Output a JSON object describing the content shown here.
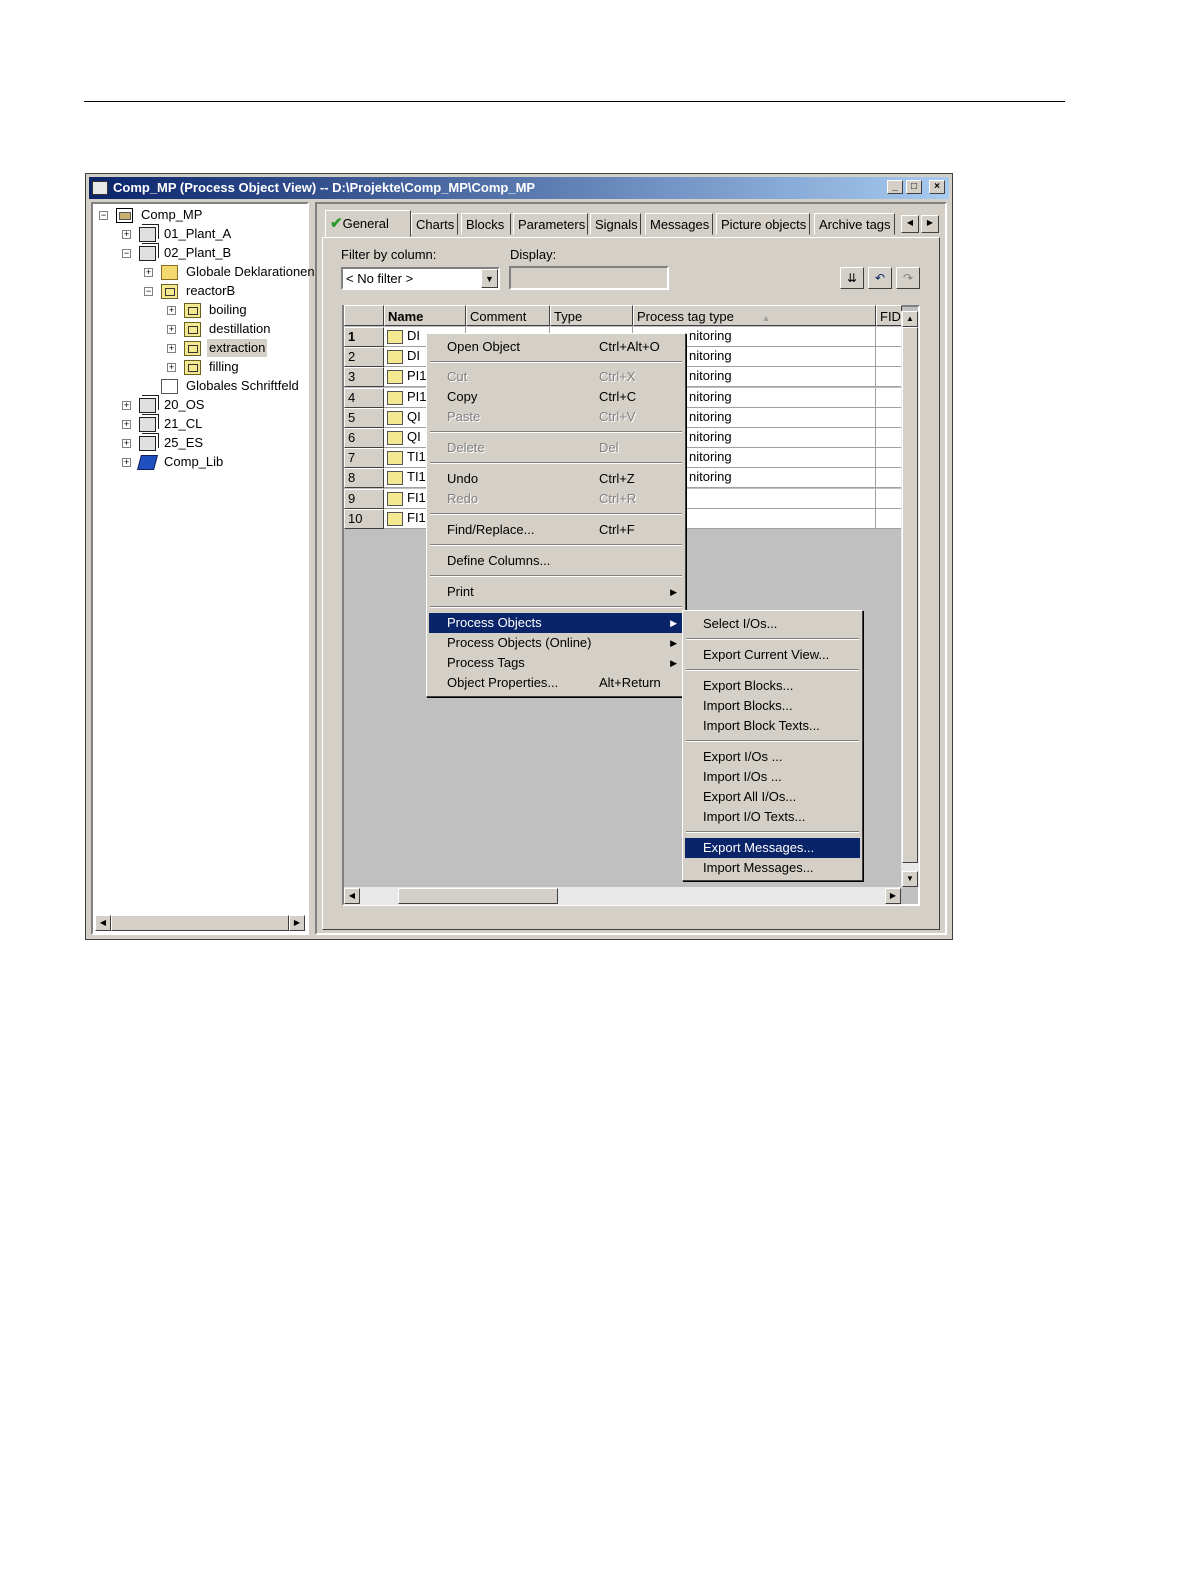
{
  "window": {
    "title": "Comp_MP (Process Object View) -- D:\\Projekte\\Comp_MP\\Comp_MP",
    "buttons": {
      "minimize": "_",
      "maximize": "□",
      "close": "×"
    }
  },
  "tree": {
    "items": [
      {
        "label": "Comp_MP",
        "icon": "project-icon",
        "expander": "−"
      },
      {
        "label": "01_Plant_A",
        "icon": "stack-icon",
        "expander": "+"
      },
      {
        "label": "02_Plant_B",
        "icon": "stack-icon",
        "expander": "−"
      },
      {
        "label": "Globale Deklarationen",
        "icon": "folder-icon",
        "expander": "+"
      },
      {
        "label": "reactorB",
        "icon": "plant-icon",
        "expander": "−"
      },
      {
        "label": "boiling",
        "icon": "plant-icon",
        "expander": "+"
      },
      {
        "label": "destillation",
        "icon": "plant-icon",
        "expander": "+"
      },
      {
        "label": "extraction",
        "icon": "plant-icon",
        "expander": "+"
      },
      {
        "label": "filling",
        "icon": "plant-icon",
        "expander": "+"
      },
      {
        "label": "Globales Schriftfeld",
        "icon": "document-icon",
        "expander": ""
      },
      {
        "label": "20_OS",
        "icon": "stack-icon",
        "expander": "+"
      },
      {
        "label": "21_CL",
        "icon": "stack-icon",
        "expander": "+"
      },
      {
        "label": "25_ES",
        "icon": "stack-icon",
        "expander": "+"
      },
      {
        "label": "Comp_Lib",
        "icon": "library-icon",
        "expander": "+"
      }
    ],
    "selected": "extraction"
  },
  "tabs": [
    "General",
    "Charts",
    "Blocks",
    "Parameters",
    "Signals",
    "Messages",
    "Picture objects",
    "Archive tags"
  ],
  "active_tab": "General",
  "filter": {
    "label": "Filter by column:",
    "value": "< No filter >",
    "display_label": "Display:",
    "display_value": ""
  },
  "table": {
    "columns": [
      "Name",
      "Comment",
      "Type",
      "Process tag type",
      "FID"
    ],
    "sort_indicator": "▲",
    "rows": [
      {
        "num": "1",
        "name": "DI",
        "tag_type": "nitoring"
      },
      {
        "num": "2",
        "name": "DI",
        "tag_type": "nitoring"
      },
      {
        "num": "3",
        "name": "PI1",
        "tag_type": "nitoring"
      },
      {
        "num": "4",
        "name": "PI1",
        "tag_type": "nitoring"
      },
      {
        "num": "5",
        "name": "QI",
        "tag_type": "nitoring"
      },
      {
        "num": "6",
        "name": "QI",
        "tag_type": "nitoring"
      },
      {
        "num": "7",
        "name": "TI1",
        "tag_type": "nitoring"
      },
      {
        "num": "8",
        "name": "TI1",
        "tag_type": "nitoring"
      },
      {
        "num": "9",
        "name": "FI1",
        "tag_type": ""
      },
      {
        "num": "10",
        "name": "FI1",
        "tag_type": ""
      }
    ]
  },
  "context_menu": {
    "items": [
      {
        "label": "Open Object",
        "shortcut": "Ctrl+Alt+O"
      },
      {
        "label": "Cut",
        "shortcut": "Ctrl+X"
      },
      {
        "label": "Copy",
        "shortcut": "Ctrl+C"
      },
      {
        "label": "Paste",
        "shortcut": "Ctrl+V"
      },
      {
        "label": "Delete",
        "shortcut": "Del"
      },
      {
        "label": "Undo",
        "shortcut": "Ctrl+Z"
      },
      {
        "label": "Redo",
        "shortcut": "Ctrl+R"
      },
      {
        "label": "Find/Replace...",
        "shortcut": "Ctrl+F"
      },
      {
        "label": "Define Columns...",
        "shortcut": ""
      },
      {
        "label": "Print",
        "shortcut": ""
      },
      {
        "label": "Process Objects",
        "shortcut": ""
      },
      {
        "label": "Process Objects (Online)",
        "shortcut": ""
      },
      {
        "label": "Process Tags",
        "shortcut": ""
      },
      {
        "label": "Object Properties...",
        "shortcut": "Alt+Return"
      }
    ]
  },
  "submenu": {
    "items": [
      "Select I/Os...",
      "Export Current View...",
      "Export Blocks...",
      "Import Blocks...",
      "Import Block Texts...",
      "Export I/Os ...",
      "Import I/Os ...",
      "Export All I/Os...",
      "Import I/O Texts...",
      "Export Messages...",
      "Import Messages..."
    ]
  },
  "colors": {
    "highlight": "#0a246a",
    "face": "#d4d0c8",
    "check": "#2a9a2a"
  }
}
